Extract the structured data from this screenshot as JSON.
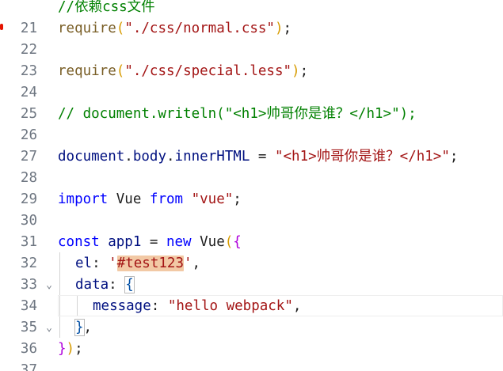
{
  "editor": {
    "lines": [
      {
        "number": "21",
        "text": "//依赖css文件"
      },
      {
        "number": "22",
        "text": "require(\"./css/normal.css\");"
      },
      {
        "number": "23",
        "text": ""
      },
      {
        "number": "24",
        "text": "require(\"./css/special.less\");"
      },
      {
        "number": "25",
        "text": ""
      },
      {
        "number": "26",
        "text": "// document.writeln(\"<h1>帅哥你是谁？</h1>\");"
      },
      {
        "number": "27",
        "text": ""
      },
      {
        "number": "28",
        "text": "document.body.innerHTML = \"<h1>帅哥你是谁？</h1>\";"
      },
      {
        "number": "29",
        "text": ""
      },
      {
        "number": "30",
        "text": "import Vue from \"vue\";"
      },
      {
        "number": "31",
        "text": ""
      },
      {
        "number": "32",
        "text": "const app1 = new Vue({"
      },
      {
        "number": "33",
        "text": "  el: '#test123',"
      },
      {
        "number": "34",
        "text": "  data: {"
      },
      {
        "number": "35",
        "text": "    message: \"hello webpack\","
      },
      {
        "number": "36",
        "text": "  },"
      },
      {
        "number": "37",
        "text": "});"
      }
    ],
    "tokens": {
      "l21": "//依赖css文件",
      "require": "require",
      "paren_open": "(",
      "paren_close": ")",
      "semi": ";",
      "l22_str": "\"./css/normal.css\"",
      "l24_str": "\"./css/special.less\"",
      "l26": "// document.writeln(\"<h1>帅哥你是谁？</h1>\");",
      "document": "document",
      "dot": ".",
      "body": "body",
      "innerHTML": "innerHTML",
      "eq": " = ",
      "l28_str": "\"<h1>帅哥你是谁？</h1>\"",
      "import": "import",
      "vue_id": " Vue ",
      "from": "from",
      "space": " ",
      "vue_str": "\"vue\"",
      "const": "const",
      "app1": " app1 ",
      "eq2": "= ",
      "new": "new",
      "vue_ctor": " Vue",
      "brace_open": "{",
      "brace_close": "}",
      "el_key": "el",
      "colon": ": ",
      "quote_single": "'",
      "test_id": "#test123",
      "comma": ",",
      "data_key": "data",
      "message_key": "message",
      "message_str": "\"hello webpack\""
    },
    "fold_markers": {
      "l32": "⌄",
      "l34": "⌄"
    }
  }
}
